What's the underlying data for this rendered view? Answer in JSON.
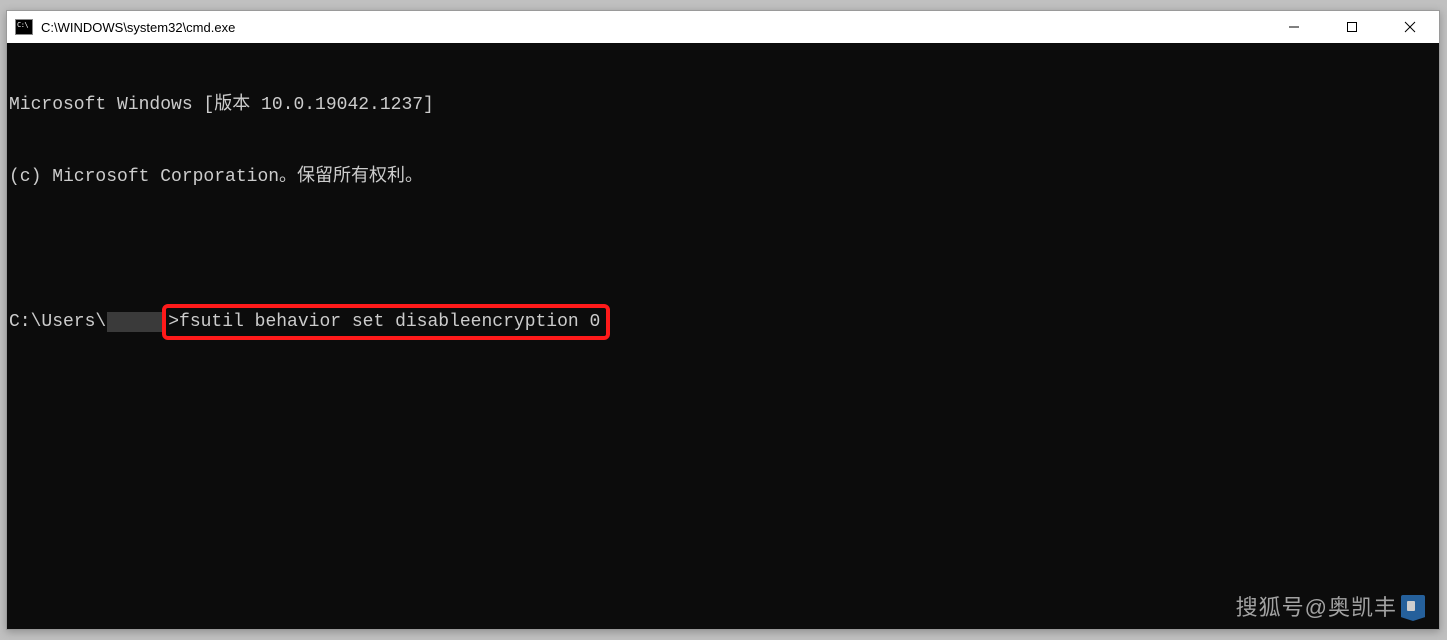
{
  "window": {
    "title": "C:\\WINDOWS\\system32\\cmd.exe"
  },
  "console": {
    "line1": "Microsoft Windows [版本 10.0.19042.1237]",
    "line2": "(c) Microsoft Corporation。保留所有权利。",
    "prompt_prefix": "C:\\Users\\",
    "prompt_suffix": ">",
    "command": "fsutil behavior set disableencryption 0"
  },
  "watermark": {
    "text": "搜狐号@奥凯丰"
  }
}
